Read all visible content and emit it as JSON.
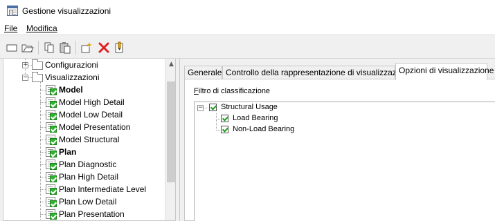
{
  "window": {
    "title": "Gestione visualizzazioni"
  },
  "menu": {
    "file": "File",
    "modifica": "Modifica"
  },
  "toolbar": {
    "icons": [
      "new-icon",
      "open-icon",
      "copy-icon",
      "paste-icon",
      "new-item-icon",
      "delete-icon",
      "rename-icon"
    ]
  },
  "tree": {
    "configurazioni": "Configurazioni",
    "visualizzazioni": "Visualizzazioni",
    "items": [
      {
        "label": "Model",
        "bold": true
      },
      {
        "label": "Model High Detail",
        "bold": false
      },
      {
        "label": "Model Low Detail",
        "bold": false
      },
      {
        "label": "Model Presentation",
        "bold": false
      },
      {
        "label": "Model Structural",
        "bold": false
      },
      {
        "label": "Plan",
        "bold": true
      },
      {
        "label": "Plan Diagnostic",
        "bold": false
      },
      {
        "label": "Plan High Detail",
        "bold": false
      },
      {
        "label": "Plan Intermediate Level",
        "bold": false
      },
      {
        "label": "Plan Low Detail",
        "bold": false
      },
      {
        "label": "Plan Presentation",
        "bold": false
      }
    ]
  },
  "tabs": [
    {
      "label": "Generale",
      "active": false
    },
    {
      "label": "Controllo della rappresentazione di visualizzazione",
      "active": false
    },
    {
      "label": "Opzioni di visualizzazione",
      "active": true
    }
  ],
  "options": {
    "filter_label_prefix": "F",
    "filter_label_rest": "iltro di classificazione",
    "filter_tree": {
      "root": "Structural Usage",
      "children": [
        "Load Bearing",
        "Non-Load Bearing"
      ]
    }
  },
  "colors": {
    "check_green": "#2db32d",
    "delete_red": "#e02020"
  }
}
